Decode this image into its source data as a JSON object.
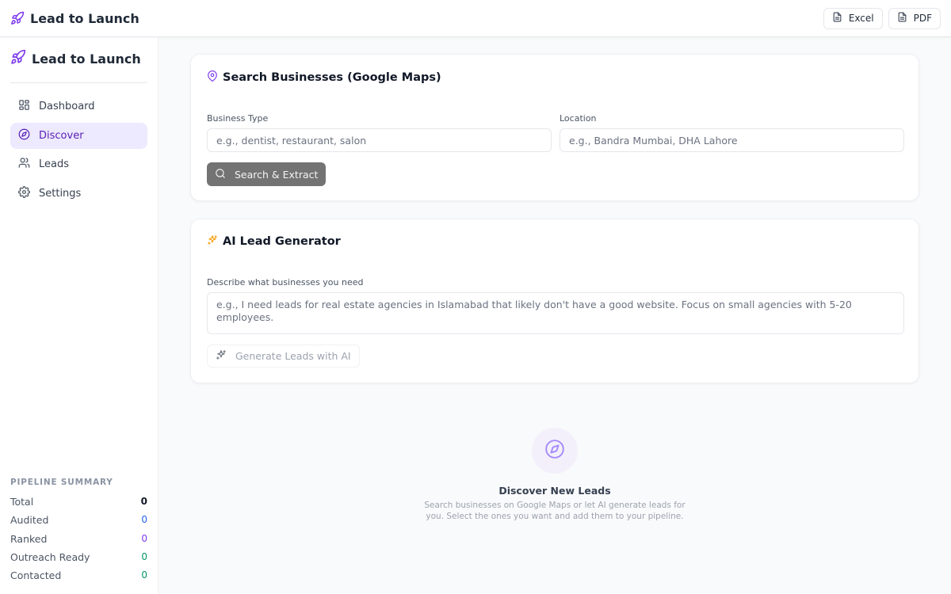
{
  "app": {
    "title": "Lead to Launch"
  },
  "header": {
    "excel_label": "Excel",
    "pdf_label": "PDF"
  },
  "sidebar": {
    "title": "Lead to Launch",
    "items": [
      {
        "label": "Dashboard",
        "icon": "grid-icon",
        "active": false
      },
      {
        "label": "Discover",
        "icon": "compass-icon",
        "active": true
      },
      {
        "label": "Leads",
        "icon": "users-icon",
        "active": false
      },
      {
        "label": "Settings",
        "icon": "gear-icon",
        "active": false
      }
    ],
    "pipeline": {
      "heading": "PIPELINE SUMMARY",
      "rows": [
        {
          "label": "Total",
          "value": "0",
          "color": "#111827"
        },
        {
          "label": "Audited",
          "value": "0",
          "color": "#2563eb"
        },
        {
          "label": "Ranked",
          "value": "0",
          "color": "#7c3aed"
        },
        {
          "label": "Outreach Ready",
          "value": "0",
          "color": "#059669"
        },
        {
          "label": "Contacted",
          "value": "0",
          "color": "#059669"
        }
      ]
    }
  },
  "search": {
    "title": "Search Businesses (Google Maps)",
    "business_type_label": "Business Type",
    "business_type_placeholder": "e.g., dentist, restaurant, salon",
    "location_label": "Location",
    "location_placeholder": "e.g., Bandra Mumbai, DHA Lahore",
    "button_label": "Search & Extract"
  },
  "ai": {
    "title": "AI Lead Generator",
    "describe_label": "Describe what businesses you need",
    "describe_placeholder": "e.g., I need leads for real estate agencies in Islamabad that likely don't have a good website. Focus on small agencies with 5-20 employees.",
    "button_label": "Generate Leads with AI"
  },
  "empty_state": {
    "title": "Discover New Leads",
    "description": "Search businesses on Google Maps or let AI generate leads for you. Select the ones you want and add them to your pipeline."
  },
  "colors": {
    "accent": "#7c3aed",
    "active_bg": "#ede9fe",
    "sparkle": "#f59e0b"
  }
}
